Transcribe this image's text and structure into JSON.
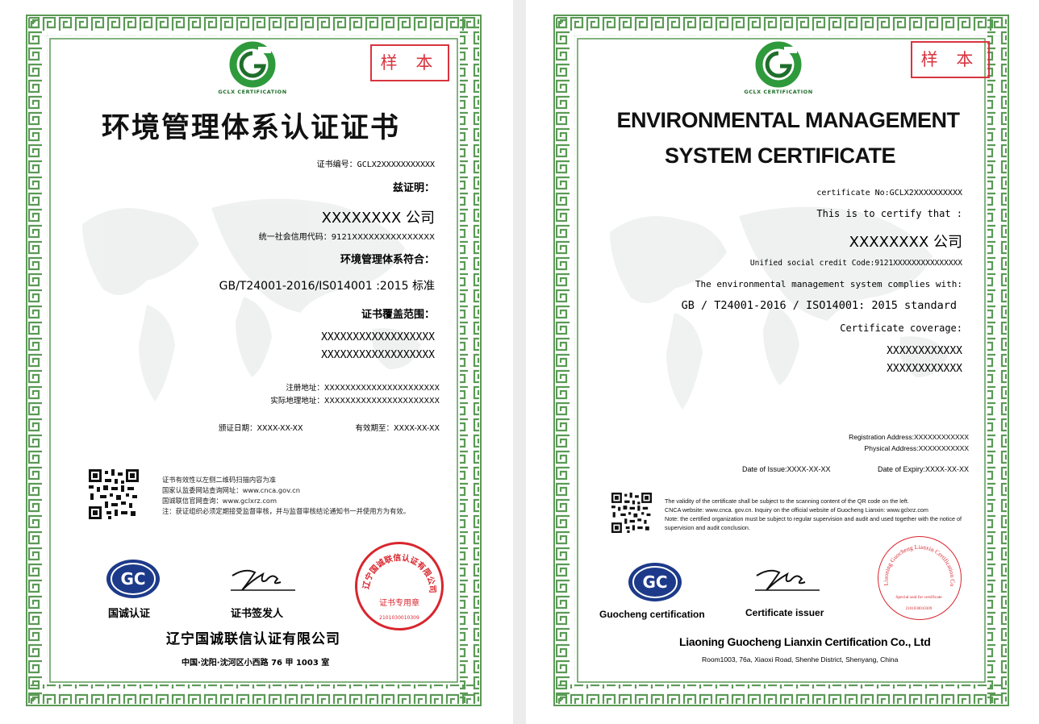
{
  "cn": {
    "sample": "样 本",
    "logo_text": "GCLX CERTIFICATION",
    "title": "环境管理体系认证证书",
    "cert_no": "证书编号：GCLX2XXXXXXXXXXX",
    "hereby": "兹证明：",
    "company": "XXXXXXXX 公司",
    "credit_code": "统一社会信用代码：9121XXXXXXXXXXXXXXX",
    "complies": "环境管理体系符合：",
    "standard": "GB/T24001-2016/IS014001 :2015 标准",
    "scope_label": "证书覆盖范围：",
    "scope_line1": "XXXXXXXXXXXXXXXXXX",
    "scope_line2": "XXXXXXXXXXXXXXXXXX",
    "reg_address": "注册地址：XXXXXXXXXXXXXXXXXXXXXX",
    "actual_address": "实际地理地址：XXXXXXXXXXXXXXXXXXXXXX",
    "issue_date": "颁证日期：XXXX-XX-XX",
    "expiry_date": "有效期至：XXXX-XX-XX",
    "note1": "证书有效性以左侧二维码扫描内容为准",
    "note2": "国家认监委网站查询网址：www.cnca.gov.cn",
    "note3": "国诚联信官网查询：www.gclxrz.com",
    "note4": "注：获证组织必须定期接受监督审核，并与监督审核结论通知书一并使用方为有效。",
    "gc_label": "国诚认证",
    "issuer_label": "证书签发人",
    "seal_text": "辽宁国诚联信认证有限公司",
    "seal_sub": "证书专用章",
    "seal_no": "2101030010309",
    "company_name": "辽宁国诚联信认证有限公司",
    "address": "中国·沈阳·沈河区小西路 76 甲 1003 室"
  },
  "en": {
    "sample": "样 本",
    "logo_text": "GCLX CERTIFICATION",
    "title_line1": "ENVIRONMENTAL MANAGEMENT",
    "title_line2": "SYSTEM CERTIFICATE",
    "cert_no": "certificate No:GCLX2XXXXXXXXXX",
    "certify": "This is to certify that :",
    "company": "XXXXXXXX 公司",
    "credit_code": "Unified social credit Code:9121XXXXXXXXXXXXXXX",
    "complies": "The environmental management system complies with:",
    "standard": "GB / T24001-2016 / ISO14001: 2015 standard",
    "coverage_label": "Certificate coverage:",
    "scope_line1": "XXXXXXXXXXXX",
    "scope_line2": "XXXXXXXXXXXX",
    "reg_address": "Registration Address:XXXXXXXXXXXX",
    "phys_address": "Physical Address:XXXXXXXXXXX",
    "issue_date": "Date of Issue:XXXX-XX-XX",
    "expiry_date": "Date of Expiry:XXXX-XX-XX",
    "note1": "The validity of the certificate shall be subject to the scanning content of the QR code on the left.",
    "note2": "CNCA website: www.cnca. gov.cn. Inquiry on the official website of Guocheng Lianxin: www.gclxrz.com",
    "note3": "Note: the certified organization must be subject to regular supervision and audit and used together with the notice of supervision and audit conclusion.",
    "gc_label": "Guocheng certification",
    "issuer_label": "Certificate issuer",
    "seal_text": "Liaoning Guocheng Lianxin Certification Co., Ltd",
    "seal_sub": "Special seal for certificate",
    "seal_no": "2101030010309",
    "company_name": "Liaoning Guocheng Lianxin Certification Co., Ltd",
    "address": "Room1003, 76a, Xiaoxi Road, Shenhe District, Shenyang, China"
  },
  "colors": {
    "border_green": "#5a9a55",
    "logo_green": "#2f9a3c",
    "sample_red": "#d9343f",
    "seal_red": "#d8262e",
    "gc_blue": "#1d3a8a"
  }
}
